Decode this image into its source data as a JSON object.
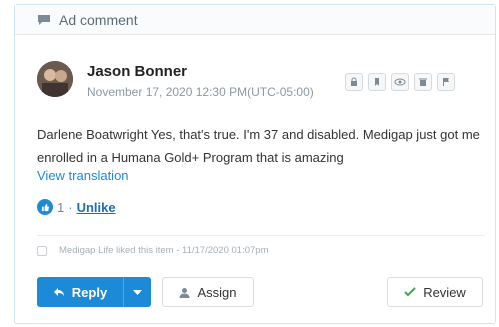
{
  "header": {
    "title": "Ad comment",
    "icon": "comment-icon"
  },
  "author": {
    "name": "Jason Bonner",
    "timestamp": "November 17, 2020 12:30 PM(UTC-05:00)"
  },
  "actions": [
    "lock-icon",
    "bookmark-icon",
    "eye-icon",
    "trash-icon",
    "flag-icon"
  ],
  "comment": {
    "text": "Darlene Boatwright Yes, that's true. I'm 37 and disabled. Medigap just got me enrolled in a Humana Gold+ Program that is amazing",
    "translate_link": "View translation"
  },
  "likes": {
    "count": "1",
    "separator": "·",
    "unlike_label": "Unlike"
  },
  "activity": {
    "text": "Medigap Life liked this item - 11/17/2020 01:07pm"
  },
  "buttons": {
    "reply": "Reply",
    "assign": "Assign",
    "review": "Review"
  },
  "colors": {
    "primary": "#1c8ad6",
    "review_check": "#3aa757"
  }
}
